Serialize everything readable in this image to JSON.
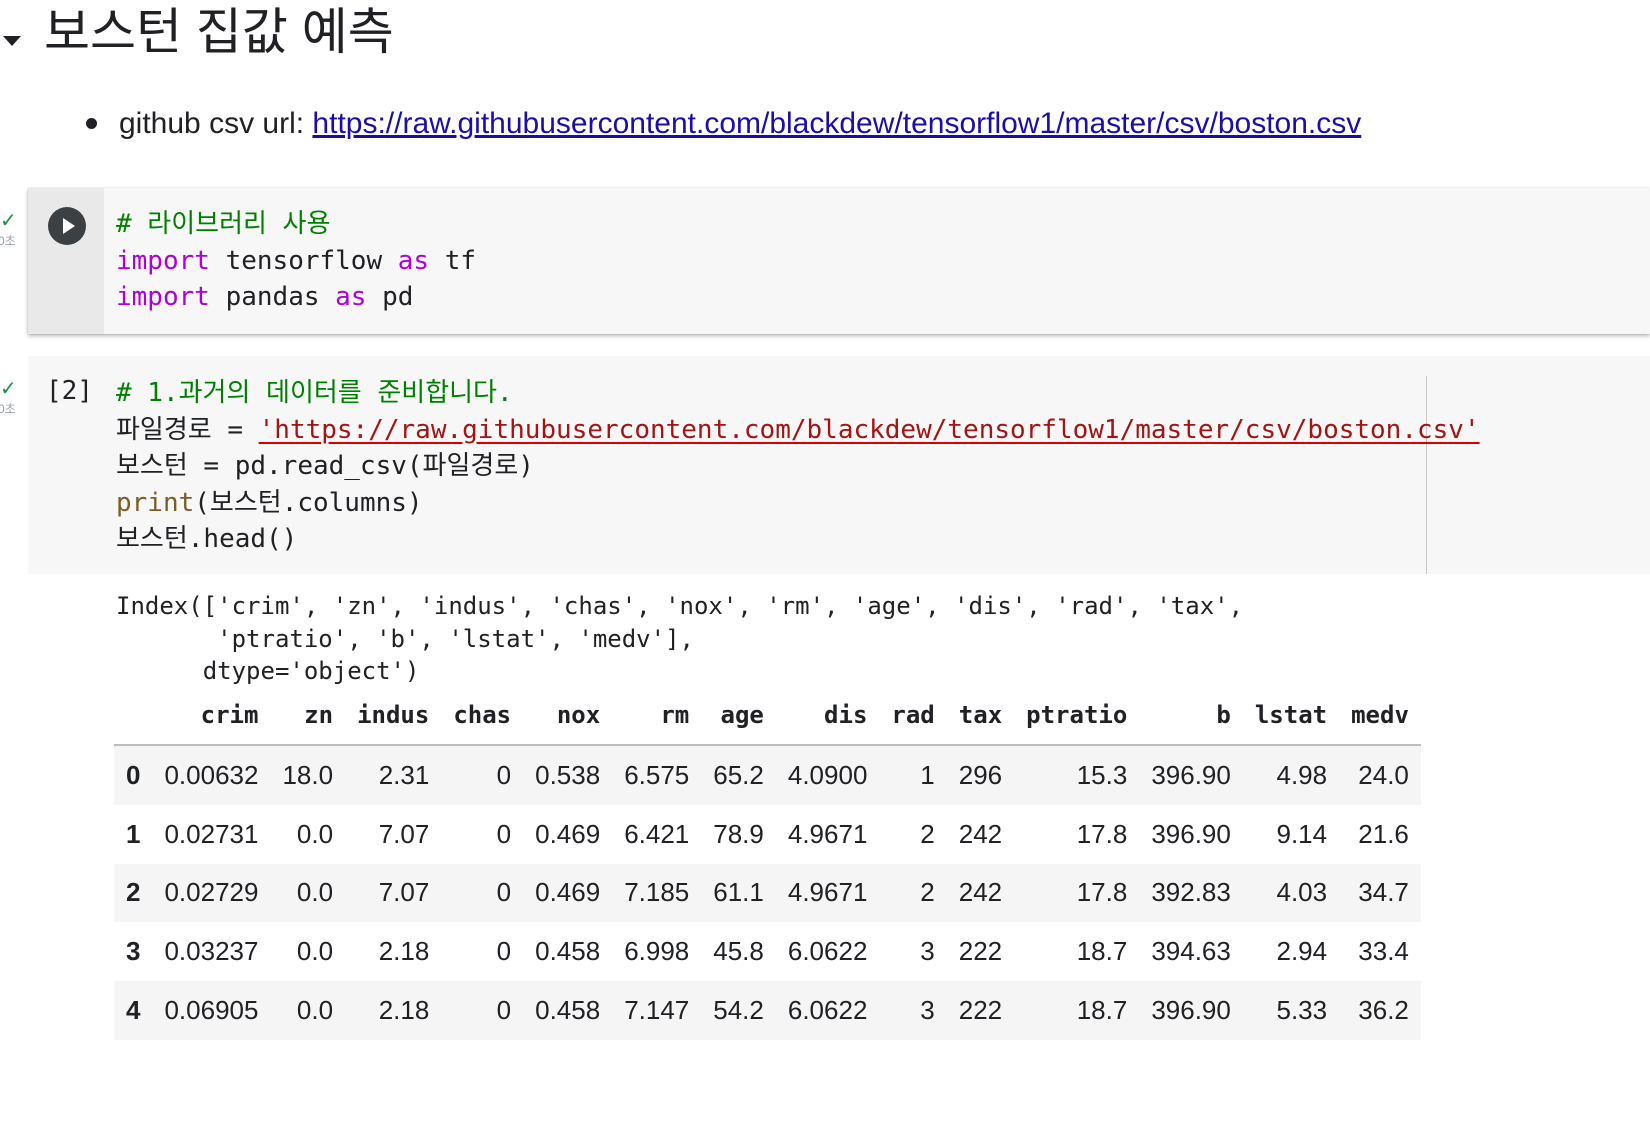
{
  "section": {
    "title": "보스턴 집값 예측"
  },
  "markdown": {
    "bullet_label": "github csv url: ",
    "link_text": "https://raw.githubusercontent.com/blackdew/tensorflow1/master/csv/boston.csv"
  },
  "cell1": {
    "status_time": "0초",
    "lines": {
      "l1_comment": "# 라이브러리 사용",
      "l2_kw1": "import",
      "l2_mod": " tensorflow ",
      "l2_kw2": "as",
      "l2_alias": " tf",
      "l3_kw1": "import",
      "l3_mod": " pandas ",
      "l3_kw2": "as",
      "l3_alias": " pd"
    }
  },
  "cell2": {
    "exec_count": "[2]",
    "status_time": "0초",
    "lines": {
      "l1_comment": "# 1.과거의 데이터를 준비합니다.",
      "l2_var": "파일경로 = ",
      "l2_str": "'https://raw.githubusercontent.com/blackdew/tensorflow1/master/csv/boston.csv'",
      "l3": "보스턴 = pd.read_csv(파일경로)",
      "l4_fn": "print",
      "l4_rest": "(보스턴.columns)",
      "l5": "보스턴.head()"
    },
    "stdout": "Index(['crim', 'zn', 'indus', 'chas', 'nox', 'rm', 'age', 'dis', 'rad', 'tax',\n       'ptratio', 'b', 'lstat', 'medv'],\n      dtype='object')"
  },
  "dataframe": {
    "columns": [
      "",
      "crim",
      "zn",
      "indus",
      "chas",
      "nox",
      "rm",
      "age",
      "dis",
      "rad",
      "tax",
      "ptratio",
      "b",
      "lstat",
      "medv"
    ],
    "rows": [
      [
        "0",
        "0.00632",
        "18.0",
        "2.31",
        "0",
        "0.538",
        "6.575",
        "65.2",
        "4.0900",
        "1",
        "296",
        "15.3",
        "396.90",
        "4.98",
        "24.0"
      ],
      [
        "1",
        "0.02731",
        "0.0",
        "7.07",
        "0",
        "0.469",
        "6.421",
        "78.9",
        "4.9671",
        "2",
        "242",
        "17.8",
        "396.90",
        "9.14",
        "21.6"
      ],
      [
        "2",
        "0.02729",
        "0.0",
        "7.07",
        "0",
        "0.469",
        "7.185",
        "61.1",
        "4.9671",
        "2",
        "242",
        "17.8",
        "392.83",
        "4.03",
        "34.7"
      ],
      [
        "3",
        "0.03237",
        "0.0",
        "2.18",
        "0",
        "0.458",
        "6.998",
        "45.8",
        "6.0622",
        "3",
        "222",
        "18.7",
        "394.63",
        "2.94",
        "33.4"
      ],
      [
        "4",
        "0.06905",
        "0.0",
        "2.18",
        "0",
        "0.458",
        "7.147",
        "54.2",
        "6.0622",
        "3",
        "222",
        "18.7",
        "396.90",
        "5.33",
        "36.2"
      ]
    ]
  },
  "icons": {
    "caret": "caret-down-icon",
    "run": "play-icon",
    "status": "check-icon"
  },
  "colors": {
    "keyword": "#af00db",
    "comment": "#008000",
    "string": "#a31515",
    "function": "#795e26",
    "link": "#1a0dab",
    "check": "#1e8e3e"
  }
}
